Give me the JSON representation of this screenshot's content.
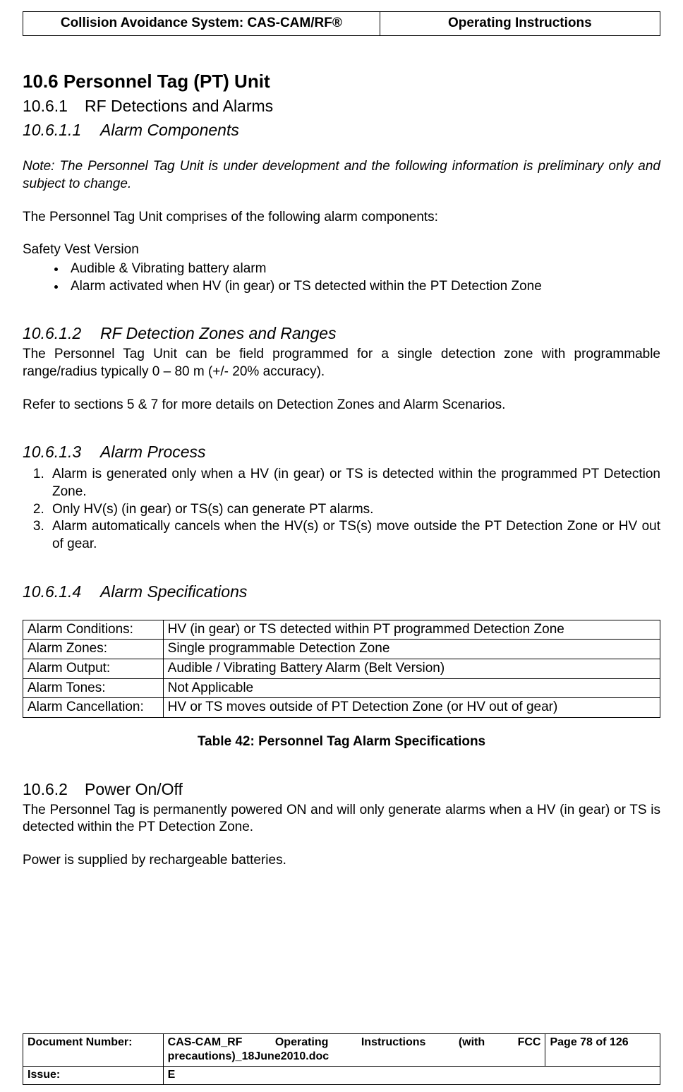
{
  "header": {
    "left": "Collision Avoidance System: CAS-CAM/RF®",
    "right": "Operating Instructions"
  },
  "section_10_6": {
    "number": "10.6",
    "title": "Personnel Tag (PT) Unit"
  },
  "section_10_6_1": {
    "number": "10.6.1",
    "title": "RF Detections and Alarms"
  },
  "section_10_6_1_1": {
    "number": "10.6.1.1",
    "title": "Alarm Components",
    "note": "Note: The Personnel Tag Unit is under development and the following information is preliminary only and subject to change.",
    "intro": "The Personnel Tag Unit comprises of the following alarm components:",
    "vest_heading": "Safety Vest Version",
    "bullets": [
      "Audible & Vibrating battery alarm",
      "Alarm activated when HV (in gear) or TS detected within the PT Detection Zone"
    ]
  },
  "section_10_6_1_2": {
    "number": "10.6.1.2",
    "title": "RF Detection Zones and Ranges",
    "p1": "The Personnel Tag Unit can be field programmed for a single detection zone with programmable range/radius typically 0 – 80 m (+/- 20% accuracy).",
    "p2": "Refer to sections 5 & 7 for more details on Detection Zones and Alarm Scenarios."
  },
  "section_10_6_1_3": {
    "number": "10.6.1.3",
    "title": "Alarm Process",
    "items": [
      "Alarm is generated only when a HV (in gear) or TS is detected within the programmed PT Detection Zone.",
      "Only HV(s) (in gear) or TS(s) can generate PT alarms.",
      "Alarm automatically cancels when the HV(s) or TS(s) move outside the PT Detection Zone or HV out of gear."
    ]
  },
  "section_10_6_1_4": {
    "number": "10.6.1.4",
    "title": "Alarm Specifications",
    "rows": [
      {
        "label": "Alarm Conditions:",
        "value": "HV (in gear) or TS detected within PT programmed Detection Zone"
      },
      {
        "label": "Alarm Zones:",
        "value": "Single programmable Detection Zone"
      },
      {
        "label": "Alarm Output:",
        "value": "Audible / Vibrating Battery Alarm (Belt Version)"
      },
      {
        "label": "Alarm Tones:",
        "value": "Not Applicable"
      },
      {
        "label": "Alarm Cancellation:",
        "value": "HV or TS moves outside of PT Detection Zone (or HV out of gear)"
      }
    ],
    "caption": "Table 42:  Personnel Tag Alarm Specifications"
  },
  "section_10_6_2": {
    "number": "10.6.2",
    "title": "Power On/Off",
    "p1": "The Personnel Tag is permanently powered ON and will only generate alarms when a HV (in gear) or TS is detected within the PT Detection Zone.",
    "p2": "Power is supplied by rechargeable batteries."
  },
  "footer": {
    "docnum_label": "Document Number:",
    "docnum_value": "CAS-CAM_RF Operating Instructions (with FCC precautions)_18June2010.doc",
    "page": "Page 78 of  126",
    "issue_label": "Issue:",
    "issue_value": "E"
  }
}
